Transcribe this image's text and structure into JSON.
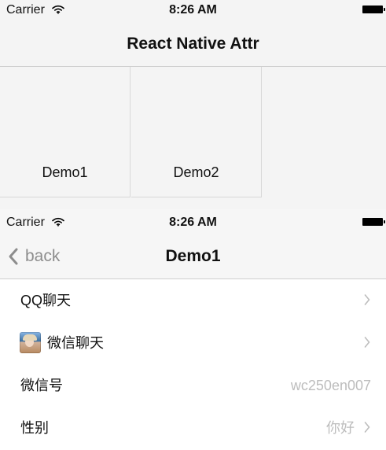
{
  "top": {
    "status": {
      "carrier": "Carrier",
      "time": "8:26 AM"
    },
    "title": "React Native Attr",
    "cells": [
      {
        "label": "Demo1"
      },
      {
        "label": "Demo2"
      }
    ]
  },
  "bottom": {
    "status": {
      "carrier": "Carrier",
      "time": "8:26 AM"
    },
    "nav": {
      "back_label": "back",
      "title": "Demo1"
    },
    "rows": [
      {
        "label": "QQ聊天",
        "value": "",
        "arrow": ">"
      },
      {
        "label": "微信聊天",
        "value": "",
        "arrow": ">"
      },
      {
        "label": "微信号",
        "value": "wc250en007",
        "arrow": ""
      },
      {
        "label": "性别",
        "value": "你好",
        "arrow": ">"
      }
    ]
  },
  "icons": {
    "wifi": "wifi-icon",
    "battery": "battery-icon",
    "back": "chevron-left-icon",
    "row_arrow": "chevron-right-icon",
    "avatar": "avatar-icon"
  },
  "colors": {
    "background": "#f2f2f2",
    "text": "#111111",
    "secondary_text": "#bdbdbd",
    "back_text": "#8d8d8d"
  }
}
